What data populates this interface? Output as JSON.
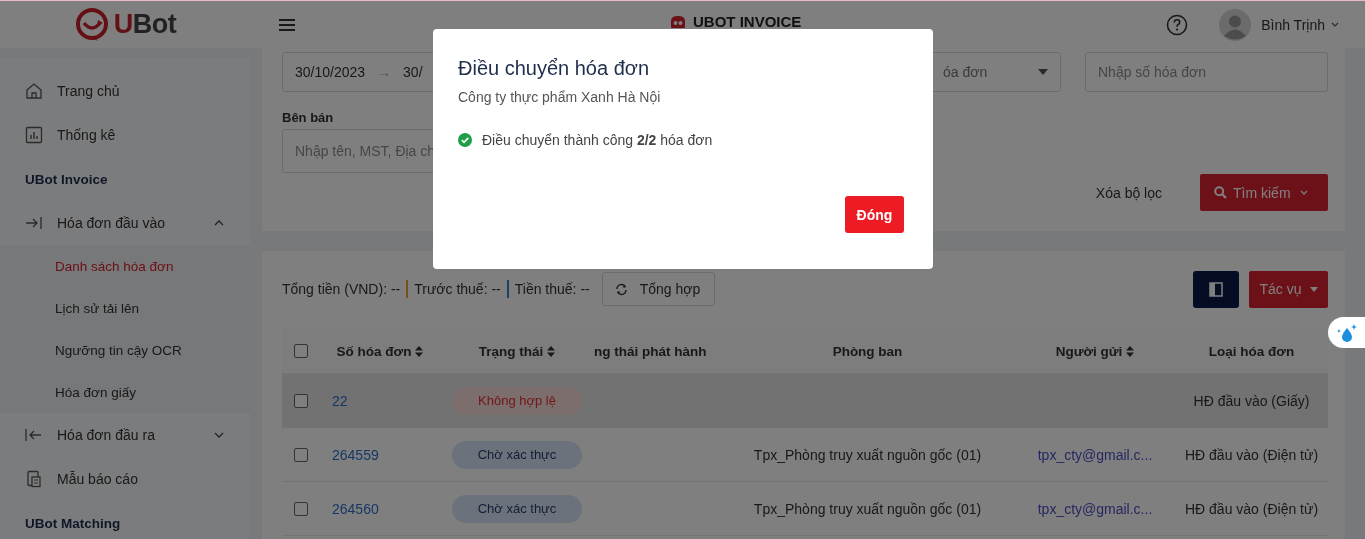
{
  "header": {
    "logo_parts": [
      "U",
      "Bot"
    ],
    "app_title": "UBOT INVOICE",
    "user_name": "Bình Trịnh"
  },
  "sidebar": {
    "items": [
      {
        "kind": "item",
        "label": "Trang chủ",
        "selected": false
      },
      {
        "kind": "item",
        "label": "Thống kê",
        "selected": false
      },
      {
        "kind": "section",
        "label": "UBot Invoice"
      },
      {
        "kind": "group",
        "label": "Hóa đơn đầu vào",
        "expanded": true,
        "children": [
          {
            "label": "Danh sách hóa đơn",
            "selected": true
          },
          {
            "label": "Lịch sử tải lên",
            "selected": false
          },
          {
            "label": "Ngưỡng tin cậy OCR",
            "selected": false
          },
          {
            "label": "Hóa đơn giấy",
            "selected": false
          }
        ]
      },
      {
        "kind": "group",
        "label": "Hóa đơn đầu ra",
        "expanded": false
      },
      {
        "kind": "item",
        "label": "Mẫu báo cáo",
        "selected": false
      },
      {
        "kind": "section",
        "label": "UBot Matching"
      }
    ]
  },
  "filters": {
    "date_from": "30/10/2023",
    "date_separator": "→",
    "date_to": "30/",
    "invoice_type": "óa đơn",
    "invoice_number_placeholder": "Nhập số hóa đơn",
    "seller_label": "Bên bán",
    "seller_placeholder": "Nhập tên, MST, Địa ch",
    "clear_label": "Xóa bộ lọc",
    "search_label": "Tìm kiếm"
  },
  "summary": {
    "items": [
      {
        "label": "Tổng tiền (VND): --"
      },
      {
        "label": "Trước thuế: --",
        "color": "#74511e"
      },
      {
        "label": "Tiền thuế: --",
        "color": "#1d4162"
      }
    ],
    "refresh_label": "Tổng hợp",
    "actions_label": "Tác vụ"
  },
  "table": {
    "all_checked": false,
    "columns": [
      {
        "label": "Số hóa đơn",
        "sortable": true
      },
      {
        "label": "Trạng thái",
        "sortable": true
      },
      {
        "label": "ng thái phát hành",
        "sortable": false
      },
      {
        "label": "Phòng ban",
        "sortable": false
      },
      {
        "label": "Người gửi",
        "sortable": true
      },
      {
        "label": "Loại hóa đơn",
        "sortable": false
      }
    ],
    "rows": [
      {
        "checked": false,
        "hovered": true,
        "number": "22",
        "status": {
          "kind": "invalid",
          "label": "Không hợp lệ"
        },
        "type": "HĐ đầu vào (Giấy)"
      },
      {
        "checked": false,
        "hovered": false,
        "number": "264559",
        "status": {
          "kind": "pending",
          "label": "Chờ xác thực"
        },
        "department": "Tpx_Phòng truy xuất nguồn gốc (01)",
        "sender": "tpx_cty@gmail.c...",
        "type": "HĐ đầu vào (Điện tử)"
      },
      {
        "checked": false,
        "hovered": false,
        "number": "264560",
        "status": {
          "kind": "pending",
          "label": "Chờ xác thực"
        },
        "department": "Tpx_Phòng truy xuất nguồn gốc (01)",
        "sender": "tpx_cty@gmail.c...",
        "type": "HĐ đầu vào (Điện tử)"
      }
    ]
  },
  "modal": {
    "title": "Điều chuyển hóa đơn",
    "subtitle": "Công ty thực phẩm Xanh Hà Nội",
    "message": "Điều chuyển thành công **2/2** hóa đơn",
    "close_label": "Đóng"
  }
}
